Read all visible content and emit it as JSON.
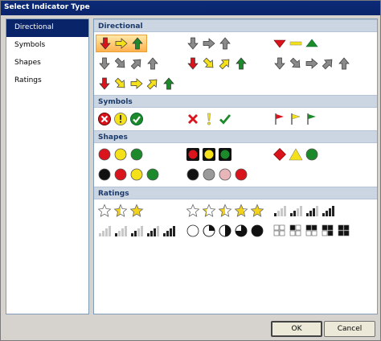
{
  "window": {
    "title": "Select Indicator Type"
  },
  "nav": {
    "items": [
      {
        "label": "Directional",
        "selected": true
      },
      {
        "label": "Symbols",
        "selected": false
      },
      {
        "label": "Shapes",
        "selected": false
      },
      {
        "label": "Ratings",
        "selected": false
      }
    ]
  },
  "sections": {
    "directional": "Directional",
    "symbols": "Symbols",
    "shapes": "Shapes",
    "ratings": "Ratings"
  },
  "indicator_sets": {
    "directional": [
      {
        "icons": [
          "red-down-arrow",
          "yellow-right-arrow",
          "green-up-arrow"
        ],
        "selected": true
      },
      {
        "icons": [
          "gray-down-arrow",
          "gray-right-arrow",
          "gray-up-arrow"
        ]
      },
      {
        "icons": [
          "red-down-triangle",
          "yellow-dash",
          "green-up-triangle"
        ]
      },
      {
        "icons": [
          "gray-down-arrow",
          "gray-down-right-arrow",
          "gray-up-right-arrow",
          "gray-up-arrow"
        ]
      },
      {
        "icons": [
          "red-down-arrow",
          "yellow-down-right-arrow",
          "yellow-up-right-arrow",
          "green-up-arrow"
        ]
      },
      {
        "icons": [
          "gray-down-arrow",
          "gray-down-right-arrow",
          "gray-right-arrow",
          "gray-up-right-arrow",
          "gray-up-arrow"
        ]
      },
      {
        "icons": [
          "red-down-arrow",
          "yellow-down-right-arrow",
          "yellow-right-arrow",
          "yellow-up-right-arrow",
          "green-up-arrow"
        ]
      }
    ],
    "symbols": [
      {
        "icons": [
          "red-x-circle",
          "yellow-exclamation-circle",
          "green-check-circle"
        ]
      },
      {
        "icons": [
          "red-x",
          "yellow-exclamation",
          "green-check"
        ]
      },
      {
        "icons": [
          "red-flag",
          "yellow-flag",
          "green-flag"
        ]
      }
    ],
    "shapes": [
      {
        "icons": [
          "red-circle",
          "yellow-circle",
          "green-circle"
        ]
      },
      {
        "icons": [
          "red-traffic-light",
          "yellow-traffic-light",
          "green-traffic-light"
        ]
      },
      {
        "icons": [
          "red-diamond",
          "yellow-triangle",
          "green-circle"
        ]
      },
      {
        "icons": [
          "black-circle",
          "red-circle",
          "yellow-circle",
          "green-circle"
        ]
      },
      {
        "icons": [
          "black-circle",
          "gray-circle",
          "pink-circle",
          "red-circle"
        ]
      }
    ],
    "ratings": [
      {
        "icons": [
          "empty-star",
          "half-star",
          "full-star"
        ]
      },
      {
        "icons": [
          "empty-star",
          "quarter-star",
          "half-star",
          "three-quarter-star",
          "full-star"
        ]
      },
      {
        "icons": [
          "signal-1",
          "signal-2",
          "signal-3",
          "signal-4"
        ]
      },
      {
        "icons": [
          "signal-0",
          "signal-1",
          "signal-2",
          "signal-3",
          "signal-4"
        ]
      },
      {
        "icons": [
          "empty-quarter",
          "quarter-quarter",
          "half-quarter",
          "three-quarter-quarter",
          "full-quarter"
        ]
      },
      {
        "icons": [
          "boxes-0",
          "boxes-1",
          "boxes-2",
          "boxes-3",
          "boxes-4"
        ]
      }
    ]
  },
  "buttons": {
    "ok": "OK",
    "cancel": "Cancel"
  },
  "colors": {
    "selection": "#0a246a",
    "section_header": "#ccd5e2",
    "selected_set": "#ffb14e",
    "red": "#d9141c",
    "yellow": "#f5e11a",
    "green": "#1c8a2a",
    "gray": "#8a8a8a"
  }
}
